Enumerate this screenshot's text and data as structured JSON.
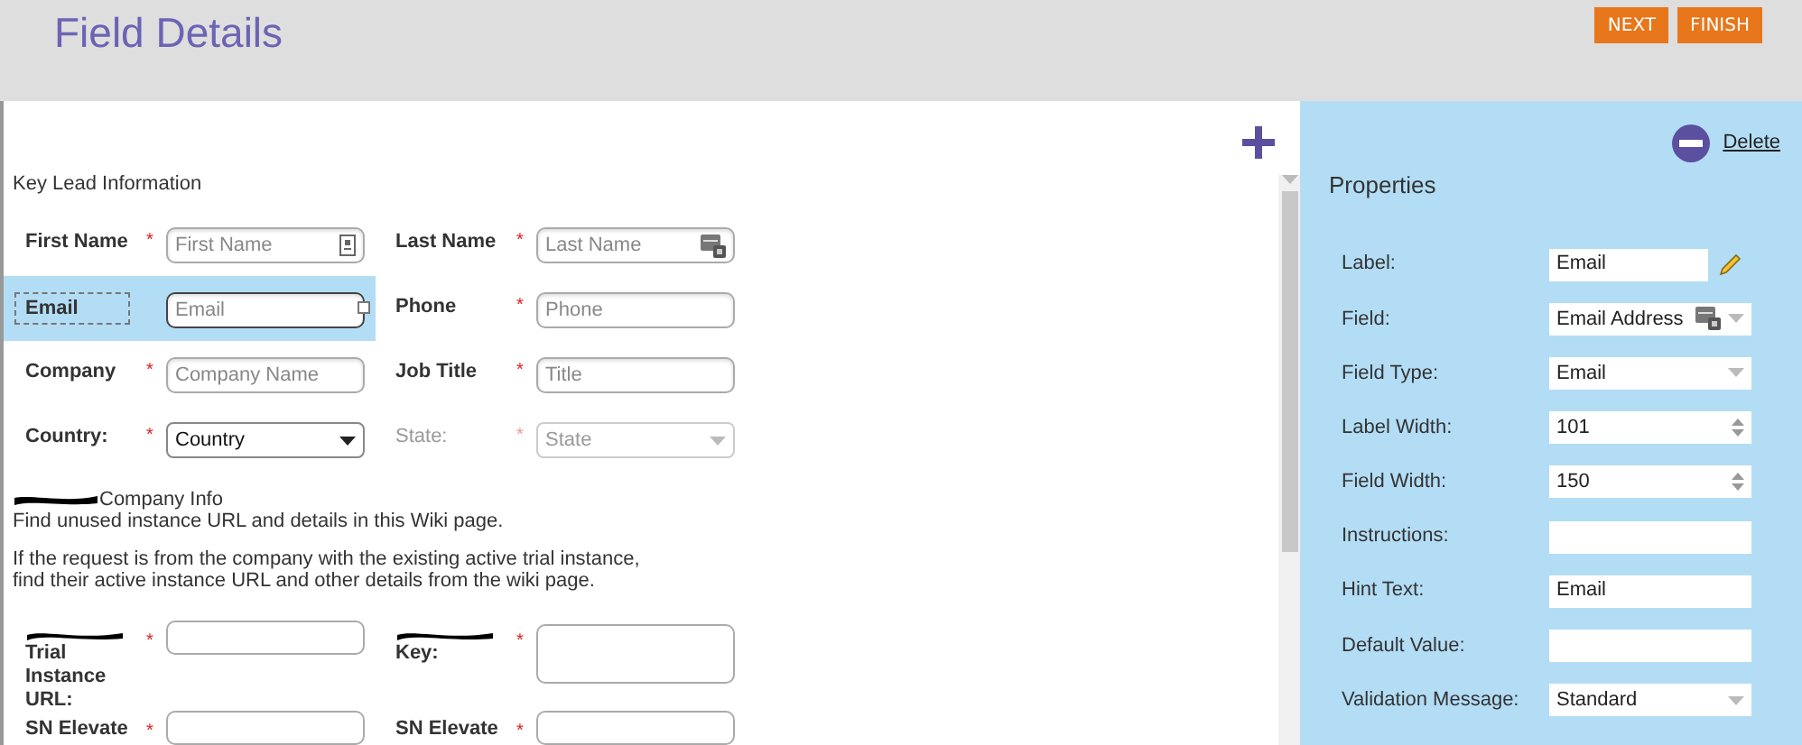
{
  "header": {
    "title": "Field Details",
    "buttons": [
      {
        "label": "NEXT"
      },
      {
        "label": "FINISH"
      }
    ]
  },
  "form": {
    "section_title": "Key Lead Information",
    "rows": [
      {
        "fields": [
          {
            "label": "First Name",
            "required_mark": "*",
            "kind": "text",
            "placeholder": "First Name",
            "selected": false,
            "disabled": false
          },
          {
            "label": "Last Name",
            "required_mark": "*",
            "kind": "text",
            "placeholder": "Last Name",
            "selected": false,
            "disabled": false
          }
        ]
      },
      {
        "fields": [
          {
            "label": "Email",
            "kind": "text",
            "placeholder": "Email",
            "selected": true,
            "disabled": false
          },
          {
            "label": "Phone",
            "required_mark": "*",
            "kind": "text",
            "placeholder": "Phone",
            "selected": false,
            "disabled": false
          }
        ]
      },
      {
        "fields": [
          {
            "label": "Company",
            "required_mark": "*",
            "kind": "text",
            "placeholder": "Company Name",
            "selected": false,
            "disabled": false
          },
          {
            "label": "Job Title",
            "required_mark": "*",
            "kind": "text",
            "placeholder": "Title",
            "selected": false,
            "disabled": false
          }
        ]
      },
      {
        "fields": [
          {
            "label": "Country:",
            "required_mark": "*",
            "kind": "select",
            "value": "Country",
            "selected": false,
            "disabled": false
          },
          {
            "label": "State:",
            "required_mark": "*",
            "kind": "select",
            "placeholder": "State",
            "selected": false,
            "disabled": true
          }
        ]
      }
    ],
    "info_title": "Company Info",
    "info_lines": [
      "Find unused instance URL and details in this Wiki page.",
      "If the request is from the company with the existing active trial instance, find their active instance URL and other details from the wiki page."
    ],
    "rows2": [
      {
        "fields": [
          {
            "label": "Trial Instance URL:",
            "required_mark": "*",
            "kind": "text",
            "redacted": true
          },
          {
            "label": "Key:",
            "required_mark": "*",
            "kind": "textarea",
            "redacted": true
          }
        ]
      },
      {
        "fields": [
          {
            "label": "SN Elevate",
            "required_mark": "*",
            "kind": "text",
            "redacted": false
          },
          {
            "label": "SN Elevate",
            "required_mark": "*",
            "kind": "text",
            "redacted": false
          }
        ]
      }
    ]
  },
  "properties": {
    "delete_label": "Delete",
    "title": "Properties",
    "items": [
      {
        "label": "Label:",
        "value": "Email",
        "kind": "editable"
      },
      {
        "label": "Field:",
        "value": "Email Address",
        "kind": "lookup"
      },
      {
        "label": "Field Type:",
        "value": "Email",
        "kind": "select"
      },
      {
        "label": "Label Width:",
        "value": "101",
        "kind": "spinner"
      },
      {
        "label": "Field Width:",
        "value": "150",
        "kind": "spinner"
      },
      {
        "label": "Instructions:",
        "kind": "text"
      },
      {
        "label": "Hint Text:",
        "value": "Email",
        "kind": "text"
      },
      {
        "label": "Default Value:",
        "kind": "text"
      },
      {
        "label": "Validation Message:",
        "value": "Standard",
        "kind": "select"
      }
    ]
  }
}
